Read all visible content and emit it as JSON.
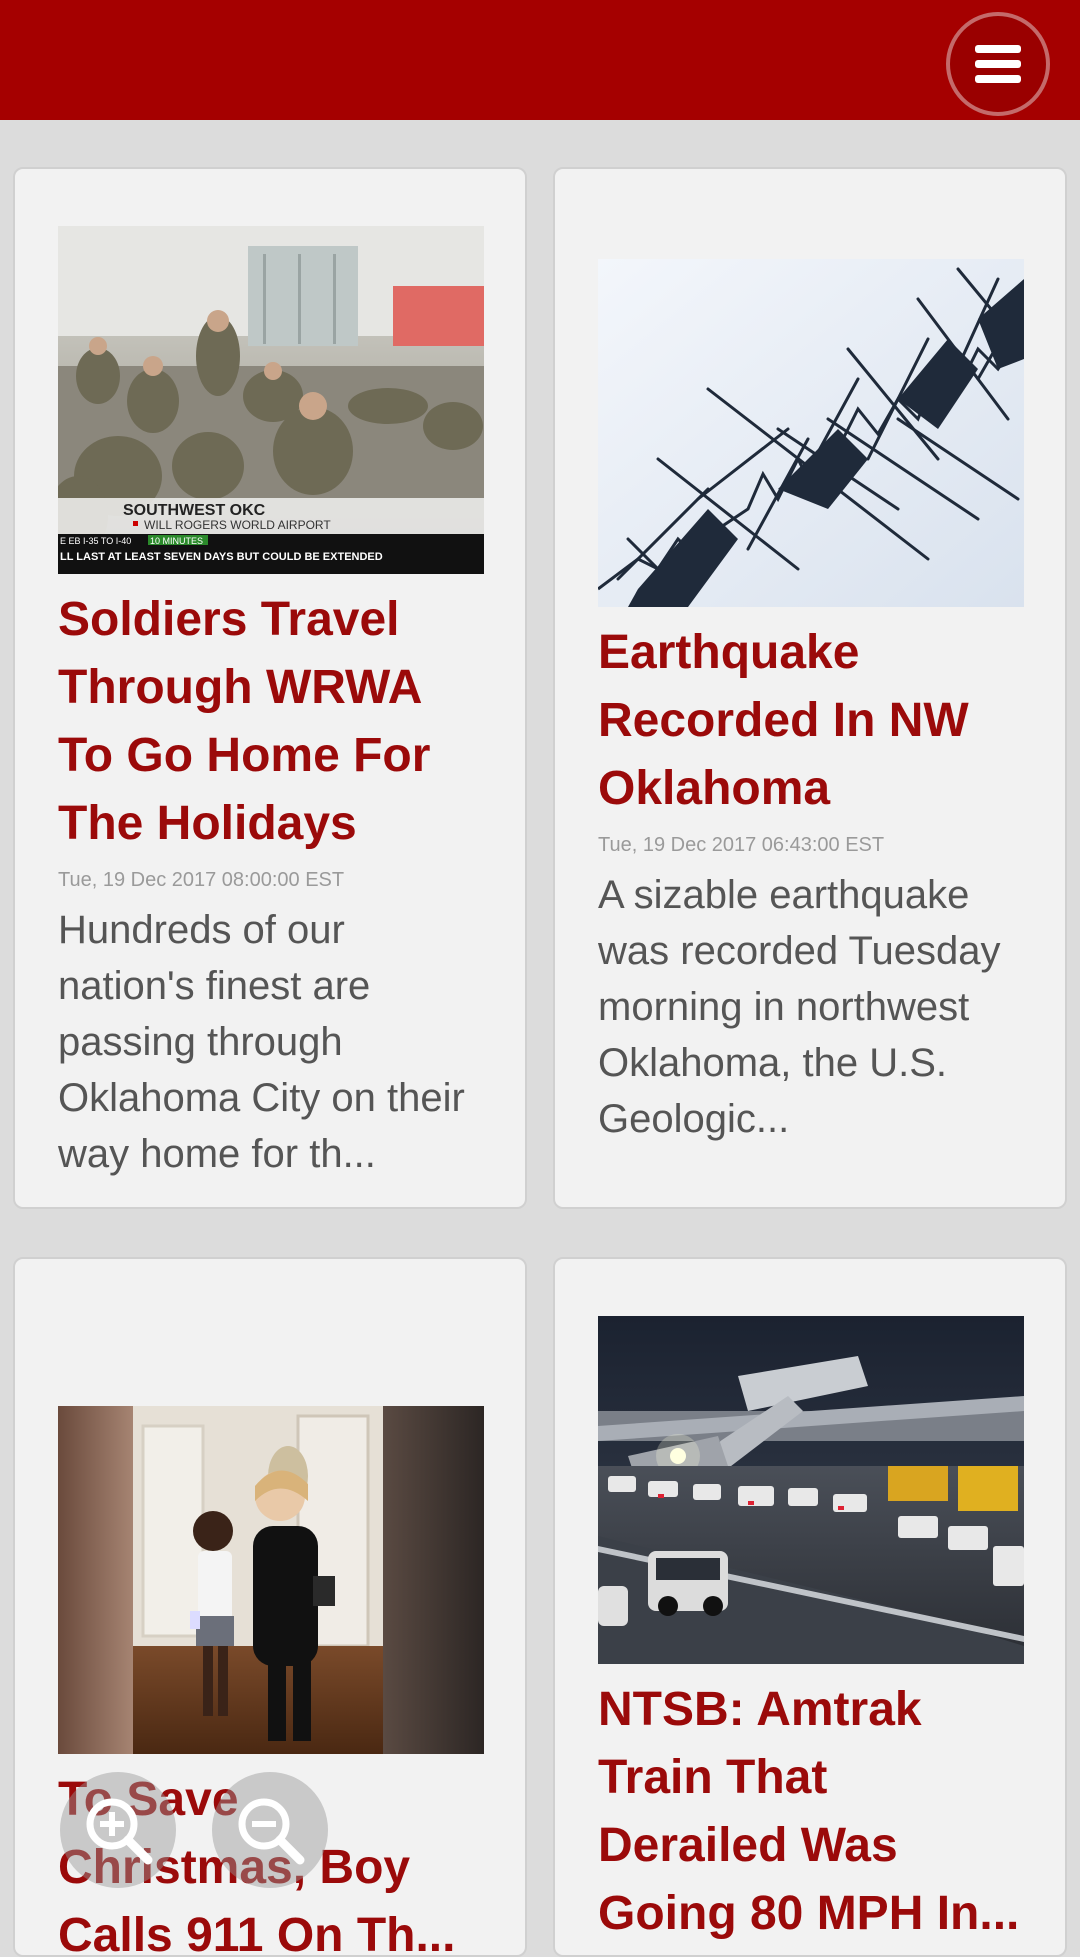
{
  "header": {
    "menu_icon": "hamburger-menu-icon",
    "bar_color": "#a50000"
  },
  "articles": [
    {
      "title": "Soldiers Travel Through WRWA To Go Home For The Holidays",
      "date": "Tue, 19 Dec 2017 08:00:00 EST",
      "excerpt": "Hundreds of our nation's finest are passing through Oklahoma City on their way home for th...",
      "image_caption": {
        "line1": "SOUTHWEST OKC",
        "line2": "WILL ROGERS WORLD AIRPORT",
        "ticker": "LL LAST AT LEAST SEVEN DAYS BUT COULD BE EXTENDED",
        "mini1": "E EB I-35 TO I-40",
        "mini2": "10 MINUTES"
      }
    },
    {
      "title": "Earthquake Recorded In NW Oklahoma",
      "date": "Tue, 19 Dec 2017 06:43:00 EST",
      "excerpt": "A sizable earthquake was recorded Tuesday morning in northwest Oklahoma, the U.S. Geologic..."
    },
    {
      "title": "To Save Christmas, Boy Calls 911 On Th..."
    },
    {
      "title": "NTSB: Amtrak Train That Derailed Was Going 80 MPH In..."
    }
  ],
  "zoom": {
    "in_icon": "zoom-in-icon",
    "out_icon": "zoom-out-icon"
  },
  "colors": {
    "headline": "#9b0a0a",
    "card_bg": "#f2f2f2",
    "page_bg": "#dcdcdc"
  }
}
